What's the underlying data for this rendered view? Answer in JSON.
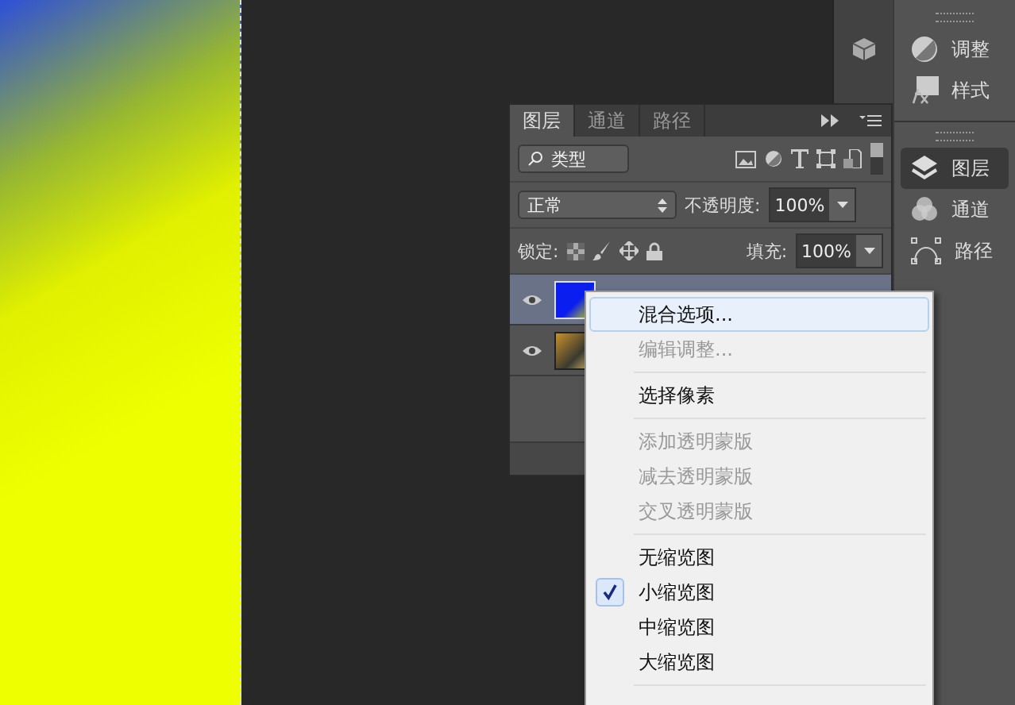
{
  "dock": {
    "items": [
      {
        "label": "调整",
        "kind": "adjust",
        "selected": false
      },
      {
        "label": "样式",
        "kind": "style",
        "selected": false
      },
      {
        "label": "图层",
        "kind": "layers",
        "selected": true
      },
      {
        "label": "通道",
        "kind": "channels",
        "selected": false
      },
      {
        "label": "路径",
        "kind": "paths",
        "selected": false
      }
    ]
  },
  "layers_panel": {
    "tabs": [
      {
        "label": "图层",
        "selected": true
      },
      {
        "label": "通道",
        "selected": false
      },
      {
        "label": "路径",
        "selected": false
      }
    ],
    "filter": {
      "value": "类型"
    },
    "blend_mode": {
      "value": "正常"
    },
    "opacity": {
      "label": "不透明度:",
      "value": "100%"
    },
    "lock": {
      "label": "锁定:"
    },
    "fill": {
      "label": "填充:",
      "value": "100%"
    },
    "layers": [
      {
        "kind": "gradient",
        "visible": true
      },
      {
        "kind": "photo",
        "visible": true
      }
    ]
  },
  "context_menu": {
    "items": [
      {
        "kind": "item",
        "label": "混合选项...",
        "selected": true,
        "disabled": false,
        "checked": false
      },
      {
        "kind": "item",
        "label": "编辑调整...",
        "selected": false,
        "disabled": true,
        "checked": false
      },
      {
        "kind": "separator"
      },
      {
        "kind": "item",
        "label": "选择像素",
        "selected": false,
        "disabled": false,
        "checked": false
      },
      {
        "kind": "separator"
      },
      {
        "kind": "item",
        "label": "添加透明蒙版",
        "selected": false,
        "disabled": true,
        "checked": false
      },
      {
        "kind": "item",
        "label": "减去透明蒙版",
        "selected": false,
        "disabled": true,
        "checked": false
      },
      {
        "kind": "item",
        "label": "交叉透明蒙版",
        "selected": false,
        "disabled": true,
        "checked": false
      },
      {
        "kind": "separator"
      },
      {
        "kind": "item",
        "label": "无缩览图",
        "selected": false,
        "disabled": false,
        "checked": false
      },
      {
        "kind": "item",
        "label": "小缩览图",
        "selected": false,
        "disabled": false,
        "checked": true
      },
      {
        "kind": "item",
        "label": "中缩览图",
        "selected": false,
        "disabled": false,
        "checked": false
      },
      {
        "kind": "item",
        "label": "大缩览图",
        "selected": false,
        "disabled": false,
        "checked": false
      },
      {
        "kind": "separator"
      }
    ]
  }
}
